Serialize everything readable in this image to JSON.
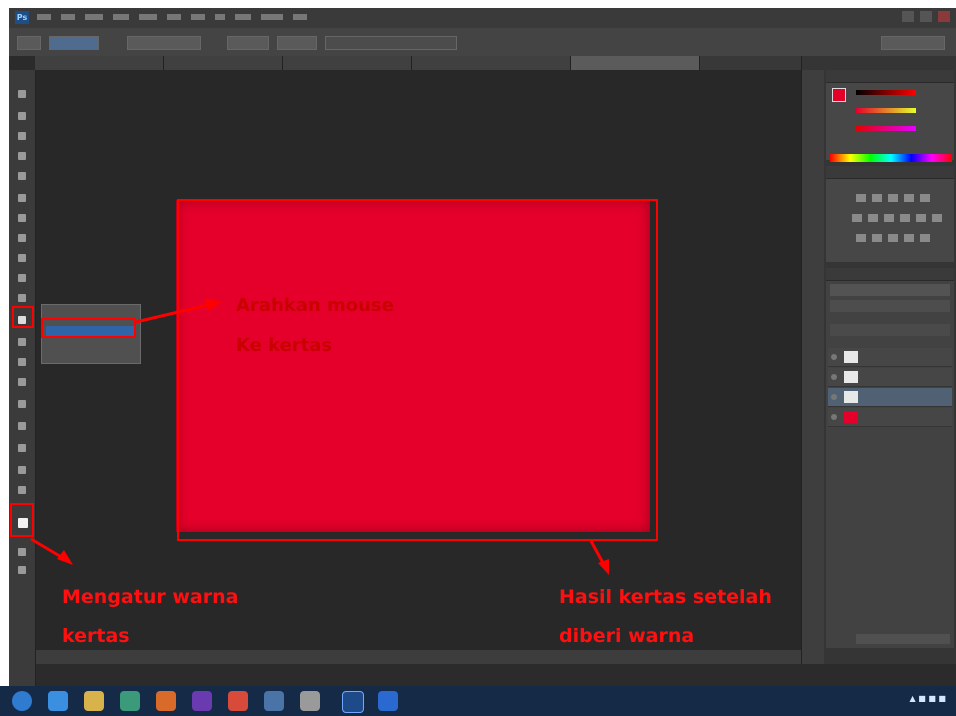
{
  "annotations": {
    "hover_line1": "Arahkan mouse",
    "hover_line2": "Ke kertas",
    "color_line1": "Mengatur warna",
    "color_line2": "kertas",
    "result_line1": "Hasil kertas setelah",
    "result_line2": "diberi warna"
  },
  "colors": {
    "paper": "#e4002b",
    "annotation": "#ff0000"
  },
  "icons": [
    "photoshop-logo-icon",
    "paint-bucket-tool-icon",
    "foreground-background-color-icon",
    "ie-icon",
    "explorer-icon",
    "start-orb-icon",
    "photoshop-taskbar-icon"
  ]
}
